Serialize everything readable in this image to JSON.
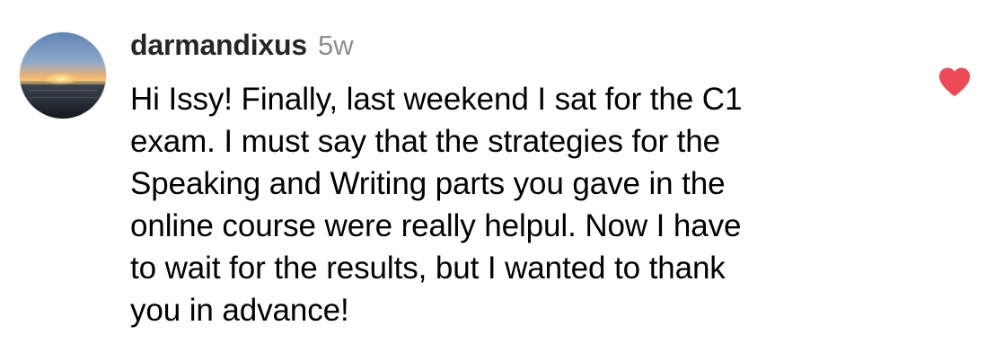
{
  "comment": {
    "username": "darmandixus",
    "timestamp": "5w",
    "avatar_icon": "sunset-avatar",
    "like_icon": "heart-filled-icon",
    "liked": true,
    "like_color": "#ed4956",
    "text_lines": [
      "Hi Issy! Finally, last weekend I sat for the C1",
      "exam. I must say that the strategies for the",
      "Speaking and Writing parts you gave in the",
      "online course were really helpul. Now I have",
      "to wait for the results, but I wanted to thank",
      "you in advance!"
    ]
  }
}
